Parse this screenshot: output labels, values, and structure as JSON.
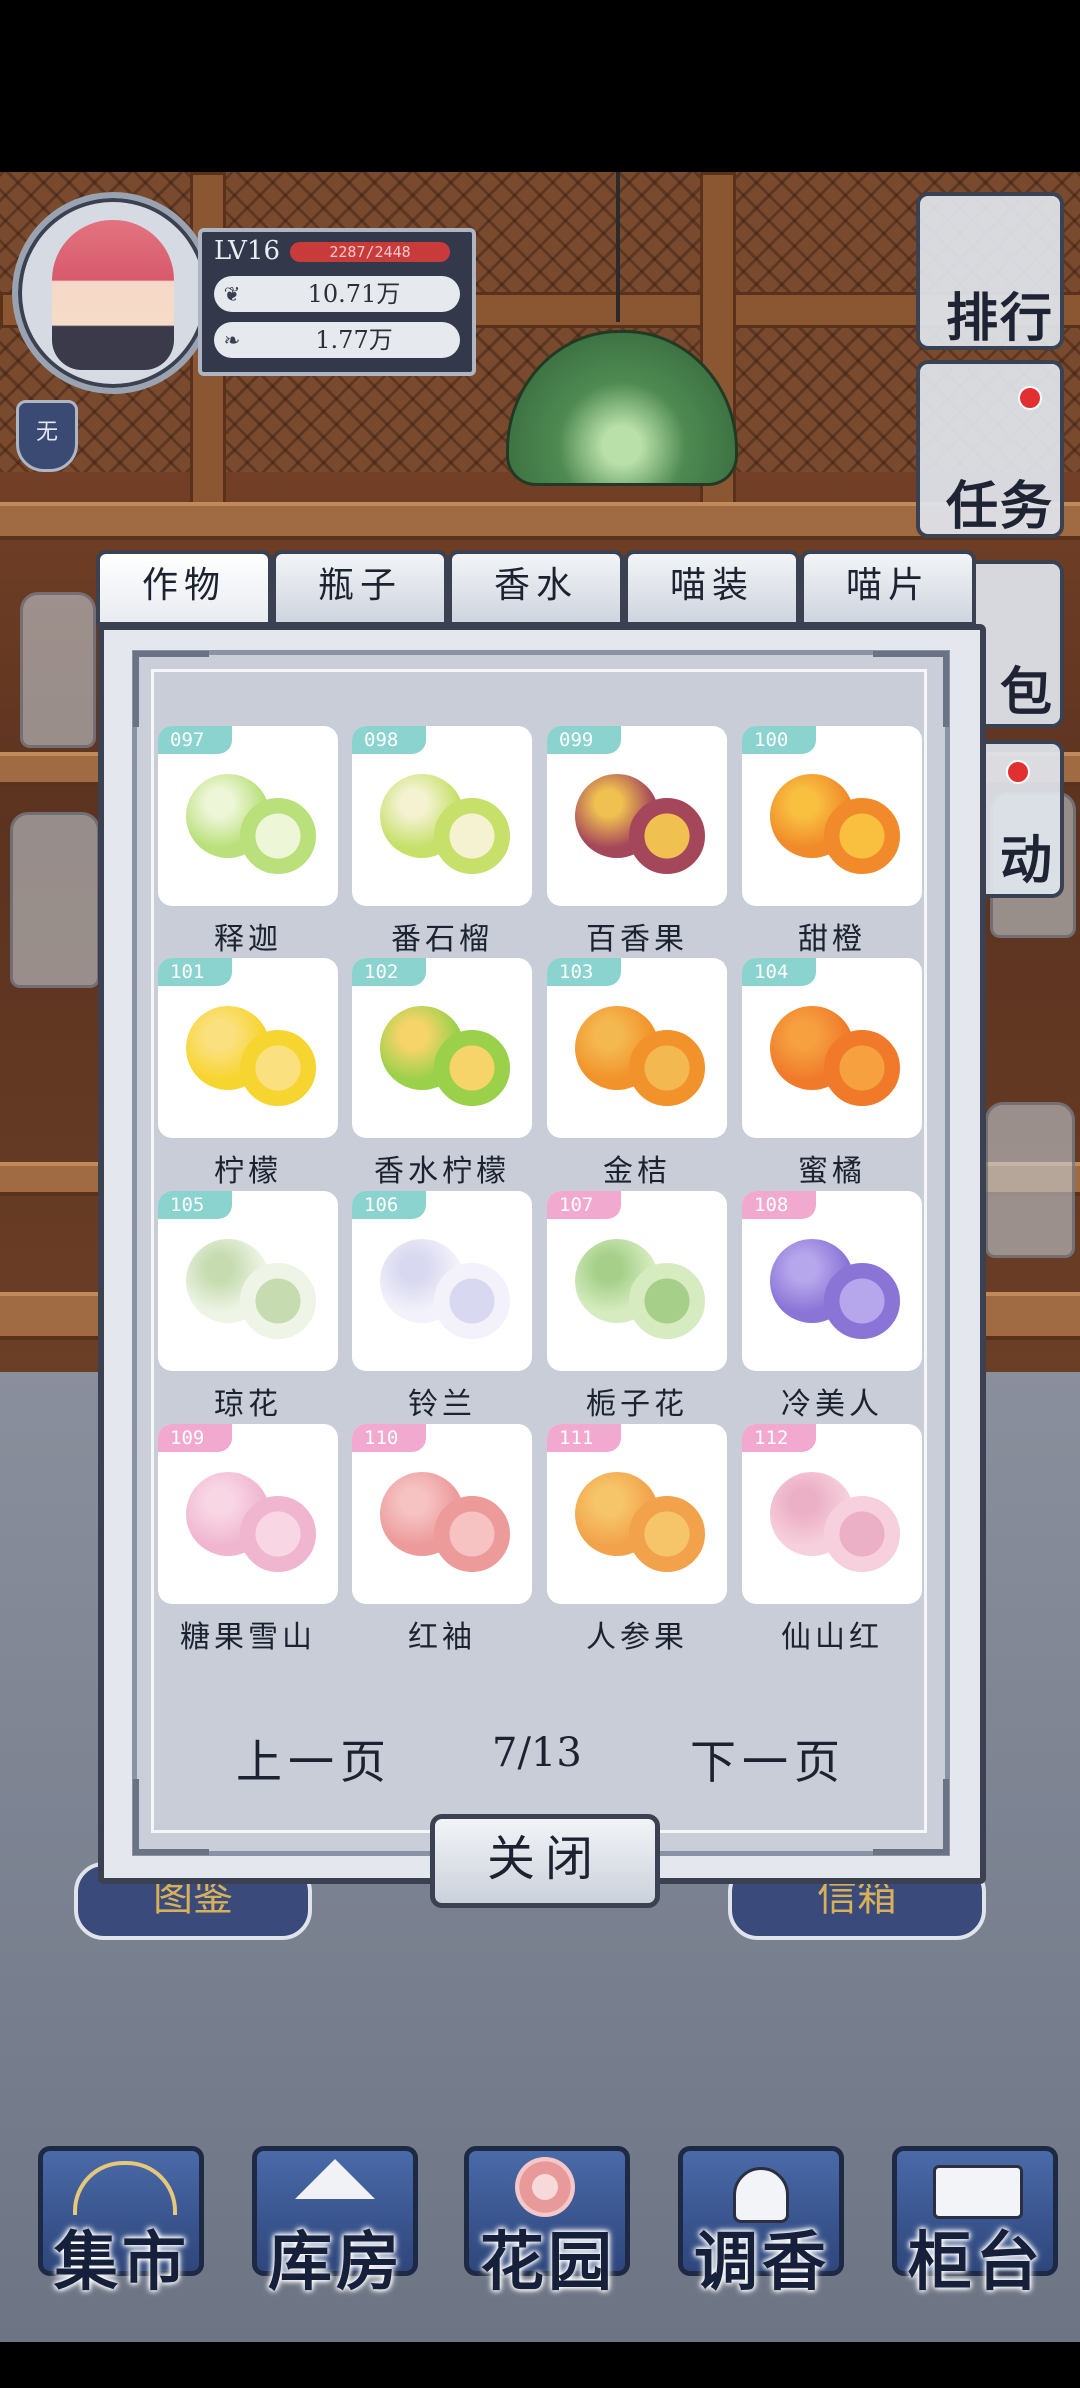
{
  "player": {
    "level": "LV16",
    "xp": "2287/2448",
    "currency_1": "10.71万",
    "currency_2": "1.77万",
    "status_badge": "无"
  },
  "right_menu": {
    "ranking": "排行",
    "tasks": "任务",
    "bag": "包",
    "events": "动"
  },
  "tabs": [
    {
      "label": "作物",
      "active": true
    },
    {
      "label": "瓶子",
      "active": false
    },
    {
      "label": "香水",
      "active": false
    },
    {
      "label": "喵装",
      "active": false
    },
    {
      "label": "喵片",
      "active": false
    }
  ],
  "items": [
    {
      "id": "097",
      "name": "释迦",
      "tag_color": "teal",
      "icon": "sugar-apple-icon"
    },
    {
      "id": "098",
      "name": "番石榴",
      "tag_color": "teal",
      "icon": "guava-icon"
    },
    {
      "id": "099",
      "name": "百香果",
      "tag_color": "teal",
      "icon": "passion-fruit-icon"
    },
    {
      "id": "100",
      "name": "甜橙",
      "tag_color": "teal",
      "icon": "orange-icon"
    },
    {
      "id": "101",
      "name": "柠檬",
      "tag_color": "teal",
      "icon": "lemon-icon"
    },
    {
      "id": "102",
      "name": "香水柠檬",
      "tag_color": "teal",
      "icon": "lime-icon"
    },
    {
      "id": "103",
      "name": "金桔",
      "tag_color": "teal",
      "icon": "kumquat-icon"
    },
    {
      "id": "104",
      "name": "蜜橘",
      "tag_color": "teal",
      "icon": "tangerine-icon"
    },
    {
      "id": "105",
      "name": "琼花",
      "tag_color": "teal",
      "icon": "qiong-flower-icon"
    },
    {
      "id": "106",
      "name": "铃兰",
      "tag_color": "teal",
      "icon": "lily-of-valley-icon"
    },
    {
      "id": "107",
      "name": "栀子花",
      "tag_color": "pink",
      "icon": "gardenia-icon"
    },
    {
      "id": "108",
      "name": "冷美人",
      "tag_color": "pink",
      "icon": "purple-rose-icon"
    },
    {
      "id": "109",
      "name": "糖果雪山",
      "tag_color": "pink",
      "icon": "pink-rose-icon"
    },
    {
      "id": "110",
      "name": "红袖",
      "tag_color": "pink",
      "icon": "red-rose-icon"
    },
    {
      "id": "111",
      "name": "人参果",
      "tag_color": "pink",
      "icon": "ginseng-fruit-icon"
    },
    {
      "id": "112",
      "name": "仙山红",
      "tag_color": "pink",
      "icon": "orchid-icon"
    }
  ],
  "pager": {
    "prev": "上一页",
    "page": "7/13",
    "next": "下一页"
  },
  "close_label": "关闭",
  "behind_signs": {
    "left": "图鉴",
    "right": "信箱"
  },
  "bottom_nav": [
    {
      "label": "集市",
      "icon": "market-gate-icon"
    },
    {
      "label": "库房",
      "icon": "warehouse-icon"
    },
    {
      "label": "花园",
      "icon": "rose-icon"
    },
    {
      "label": "调香",
      "icon": "perfume-dropper-icon"
    },
    {
      "label": "柜台",
      "icon": "counter-icon"
    }
  ],
  "colors": {
    "tag_teal": "#8bd3cf",
    "tag_pink": "#f2a9cf",
    "xp_bar": "#c93b3b",
    "frame_dark": "#3b4150"
  }
}
